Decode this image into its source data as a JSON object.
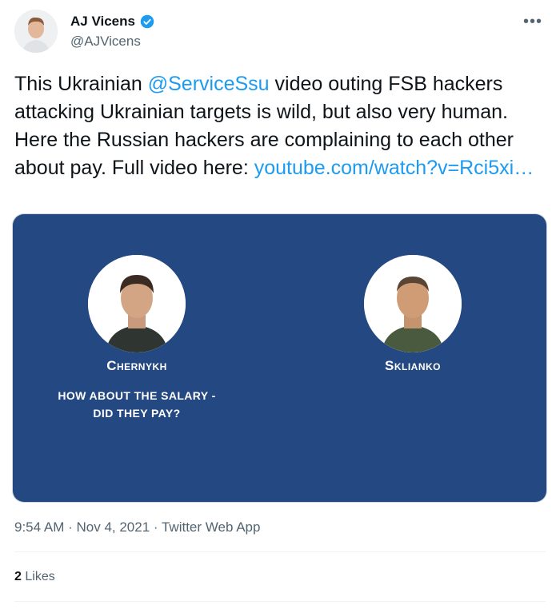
{
  "author": {
    "name": "AJ Vicens",
    "handle": "@AJVicens",
    "verified": true,
    "verified_color": "#1d9bf0"
  },
  "more_icon": "more-horizontal-icon",
  "tweet": {
    "text_part1": "This Ukrainian ",
    "mention": "@ServiceSsu",
    "text_part2": " video outing FSB hackers attacking Ukrainian targets is wild, but also very human. Here the Russian hackers are complaining to each other about pay. Full video here: ",
    "link": "youtube.com/watch?v=Rci5xi…"
  },
  "media": {
    "background": "#244882",
    "left_person_name": "Chernykh",
    "right_person_name": "Sklianko",
    "subtitle_line1": "HOW ABOUT THE SALARY -",
    "subtitle_line2": "DID THEY PAY?"
  },
  "meta": {
    "time": "9:54 AM",
    "date": "Nov 4, 2021",
    "source": "Twitter Web App",
    "separator": " · "
  },
  "engagement": {
    "likes_count": "2",
    "likes_label": "Likes"
  },
  "colors": {
    "link": "#1d9bf0",
    "secondary_text": "#536471"
  }
}
